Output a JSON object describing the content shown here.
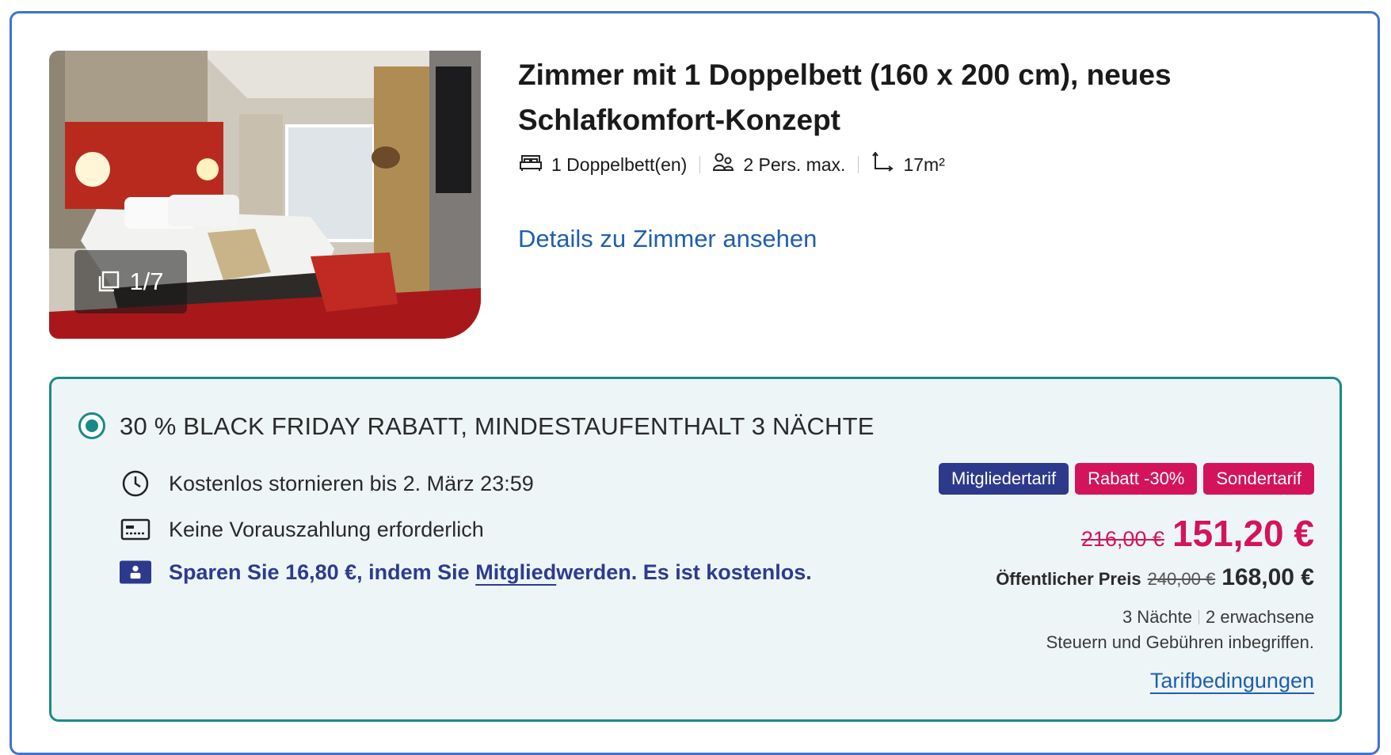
{
  "room": {
    "title": "Zimmer mit 1 Doppelbett (160 x 200 cm), neues Schlafkomfort-Konzept",
    "photo_counter": "1/7",
    "features": [
      {
        "icon": "bed-icon",
        "label": "1 Doppelbett(en)"
      },
      {
        "icon": "people-icon",
        "label": "2 Pers. max."
      },
      {
        "icon": "area-icon",
        "label": "17m²"
      }
    ],
    "details_link": "Details zu Zimmer ansehen"
  },
  "offer": {
    "title": "30 % BLACK FRIDAY RABATT, MINDESTAUFENTHALT 3 NÄCHTE",
    "cancellation": "Kostenlos stornieren bis 2. März 23:59",
    "prepayment": "Keine Vorauszahlung erforderlich",
    "member_prefix": "Sparen Sie 16,80 €, indem Sie ",
    "member_link": "Mitglied",
    "member_suffix": "werden. Es ist kostenlos.",
    "badges": [
      "Mitgliedertarif",
      "Rabatt -30%",
      "Sondertarif"
    ],
    "old_price": "216,00 €",
    "new_price": "151,20 €",
    "public_label": "Öffentlicher Preis",
    "public_old_price": "240,00 €",
    "public_price": "168,00 €",
    "nights": "3 Nächte",
    "guests": "2 erwachsene",
    "tax_note": "Steuern und Gebühren inbegriffen.",
    "tariff_link": "Tarifbedingungen"
  },
  "colors": {
    "card_border": "#3f72d6",
    "offer_border": "#1a8a86",
    "offer_bg": "#eef5f6",
    "accent_red": "#d4145a",
    "member_blue": "#2d3a8c",
    "link_blue": "#1f5fae"
  }
}
